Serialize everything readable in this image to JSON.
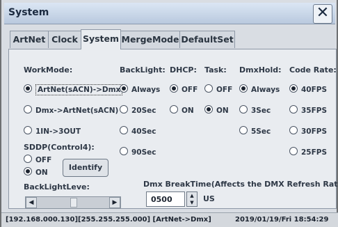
{
  "window": {
    "title": "System",
    "close_glyph": "✕"
  },
  "tabs": [
    {
      "label": "ArtNet",
      "active": false
    },
    {
      "label": "Clock",
      "active": false
    },
    {
      "label": "System",
      "active": true
    },
    {
      "label": "MergeMode",
      "active": false
    },
    {
      "label": "DefaultSet",
      "active": false
    }
  ],
  "headers": {
    "workmode": "WorkMode:",
    "backlight": "BackLight:",
    "dhcp": "DHCP:",
    "task": "Task:",
    "dmxhold": "DmxHold:",
    "coderate": "Code Rate:"
  },
  "workmode": [
    {
      "label": "ArtNet(sACN)->Dmx",
      "selected": true
    },
    {
      "label": "Dmx->ArtNet(sACN)",
      "selected": false
    },
    {
      "label": "1IN->3OUT",
      "selected": false
    }
  ],
  "backlight": [
    {
      "label": "Always",
      "selected": true
    },
    {
      "label": "20Sec",
      "selected": false
    },
    {
      "label": "40Sec",
      "selected": false
    },
    {
      "label": "90Sec",
      "selected": false
    }
  ],
  "dhcp": [
    {
      "label": "OFF",
      "selected": true
    },
    {
      "label": "ON",
      "selected": false
    }
  ],
  "task": [
    {
      "label": "OFF",
      "selected": false
    },
    {
      "label": "ON",
      "selected": true
    }
  ],
  "dmxhold": [
    {
      "label": "Always",
      "selected": true
    },
    {
      "label": "3Sec",
      "selected": false
    },
    {
      "label": "5Sec",
      "selected": false
    }
  ],
  "coderate": [
    {
      "label": "40FPS",
      "selected": true
    },
    {
      "label": "35FPS",
      "selected": false
    },
    {
      "label": "30FPS",
      "selected": false
    },
    {
      "label": "25FPS",
      "selected": false
    }
  ],
  "sddp": {
    "label": "SDDP(Control4):",
    "options": [
      {
        "label": "OFF",
        "selected": false
      },
      {
        "label": "ON",
        "selected": true
      }
    ],
    "identify_label": "Identify"
  },
  "backlight_level": {
    "label": "BackLightLeve:",
    "left_arrow": "◀",
    "right_arrow": "▶"
  },
  "dmx_break": {
    "label": "Dmx BreakTime(Affects the DMX Refresh Rate):",
    "value": "0500",
    "unit": "US",
    "up": "▲",
    "down": "▼"
  },
  "status": {
    "text": "[192.168.000.130][255.255.255.000] [ArtNet->Dmx]",
    "datetime": "2019/01/19/Fri 18:54:29"
  }
}
